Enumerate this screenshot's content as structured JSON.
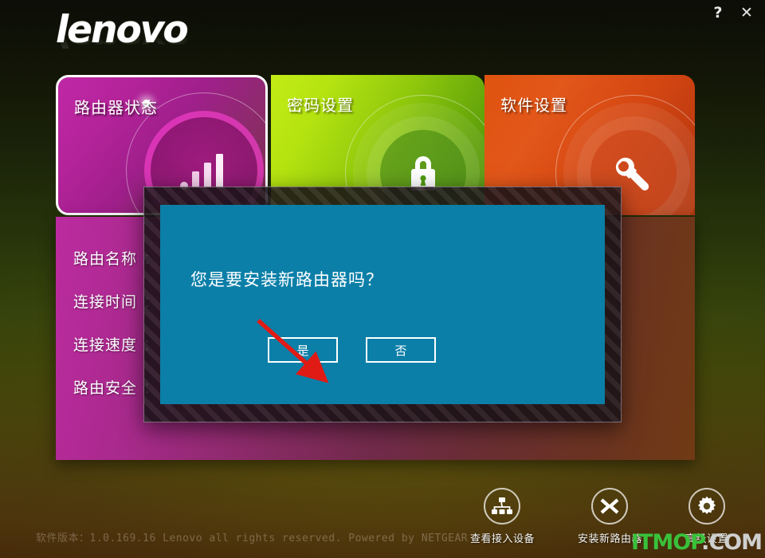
{
  "window": {
    "help_label": "?",
    "close_label": "✕"
  },
  "brand": {
    "logo_text": "lenovo"
  },
  "tiles": [
    {
      "title": "路由器状态",
      "icon": "signal-bars-icon",
      "accent": "#bc28a0"
    },
    {
      "title": "密码设置",
      "icon": "lock-icon",
      "accent": "#9ad30e"
    },
    {
      "title": "软件设置",
      "icon": "wrench-icon",
      "accent": "#e0530f"
    }
  ],
  "info_panel": {
    "rows": [
      {
        "label": "路由名称",
        "separator": "：",
        "value": ""
      },
      {
        "label": "连接时间",
        "separator": "：",
        "value": ""
      },
      {
        "label": "连接速度",
        "separator": "：",
        "value": ""
      },
      {
        "label": "路由安全",
        "separator": "：",
        "value": ""
      }
    ]
  },
  "dialog": {
    "message": "您是要安装新路由器吗？",
    "confirm_label": "是",
    "cancel_label": "否",
    "background_color": "#0b7fa8"
  },
  "annotation": {
    "type": "red-arrow",
    "color": "#e01b15",
    "points_to": "是"
  },
  "toolbar": [
    {
      "label": "查看接入设备",
      "icon": "network-tree-icon"
    },
    {
      "label": "安装新路由器",
      "icon": "connect-chevrons-icon"
    },
    {
      "label": "高级设置",
      "icon": "gear-icon"
    }
  ],
  "footer": {
    "text": "软件版本：1.0.169.16  Lenovo all rights reserved.   Powered by NETGEAR"
  },
  "watermark": {
    "main": "ITMOP",
    "suffix": ".COM"
  }
}
